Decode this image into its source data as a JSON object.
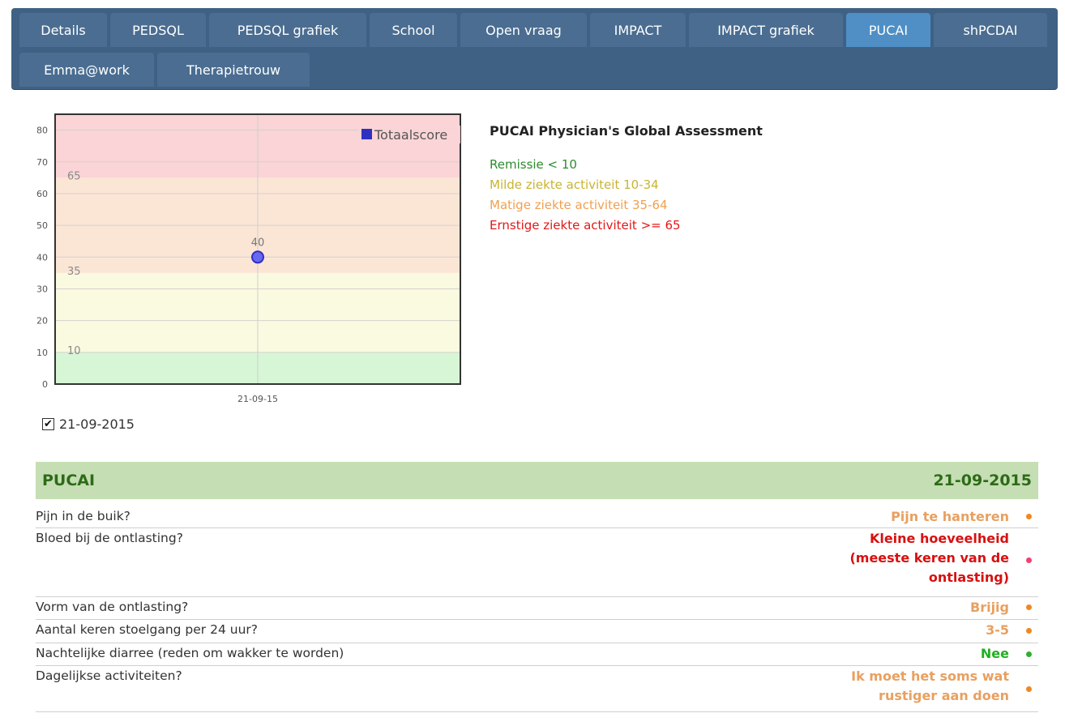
{
  "tabs": [
    {
      "label": "Details",
      "active": false
    },
    {
      "label": "PEDSQL",
      "active": false
    },
    {
      "label": "PEDSQL grafiek",
      "active": false
    },
    {
      "label": "School",
      "active": false
    },
    {
      "label": "Open vraag",
      "active": false
    },
    {
      "label": "IMPACT",
      "active": false
    },
    {
      "label": "IMPACT grafiek",
      "active": false
    },
    {
      "label": "PUCAI",
      "active": true
    },
    {
      "label": "shPCDAI",
      "active": false
    },
    {
      "label": "Emma@work",
      "active": false
    },
    {
      "label": "Therapietrouw",
      "active": false
    }
  ],
  "chart_data": {
    "type": "scatter",
    "title": "",
    "xlabel": "",
    "ylabel": "",
    "categories": [
      "21-09-15"
    ],
    "series": [
      {
        "name": "Totaalscore",
        "values": [
          40
        ],
        "color": "#4848ee"
      }
    ],
    "data_labels": [
      "40"
    ],
    "ylim": [
      0,
      85
    ],
    "yticks": [
      0,
      10,
      20,
      30,
      40,
      50,
      60,
      70,
      80
    ],
    "grid": true,
    "legend": "top-right",
    "bands": [
      {
        "from": 0,
        "to": 10,
        "color": "#d6f6d6"
      },
      {
        "from": 10,
        "to": 35,
        "color": "#fafae0"
      },
      {
        "from": 35,
        "to": 65,
        "color": "#fbe6d6"
      },
      {
        "from": 65,
        "to": 85,
        "color": "#fad4d6"
      }
    ],
    "band_labels": [
      "10",
      "35",
      "65"
    ]
  },
  "date_checkbox": {
    "label": "21-09-2015",
    "checked": true
  },
  "legend_info": {
    "title": "PUCAI Physician's Global Assessment",
    "lines": [
      {
        "text": "Remissie < 10",
        "color": "green"
      },
      {
        "text": "Milde ziekte activiteit 10-34",
        "color": "yellow"
      },
      {
        "text": "Matige ziekte activiteit 35-64",
        "color": "orange"
      },
      {
        "text": "Ernstige ziekte activiteit >= 65",
        "color": "red"
      }
    ]
  },
  "pucai": {
    "title": "PUCAI",
    "date": "21-09-2015",
    "questions": [
      {
        "q": "Pijn in de buik?",
        "a_lines": [
          "Pijn te hanteren"
        ],
        "status": "orange"
      },
      {
        "q": "Bloed bij de ontlasting?",
        "a_lines": [
          "Kleine hoeveelheid",
          "(meeste keren van de",
          "ontlasting)"
        ],
        "status": "red"
      },
      {
        "q": "Vorm van de ontlasting?",
        "a_lines": [
          "Brijig"
        ],
        "status": "orange"
      },
      {
        "q": "Aantal keren stoelgang per 24 uur?",
        "a_lines": [
          "3-5"
        ],
        "status": "orange"
      },
      {
        "q": "Nachtelijke diarree (reden om wakker te worden)",
        "a_lines": [
          "Nee"
        ],
        "status": "green"
      },
      {
        "q": "Dagelijkse activiteiten?",
        "a_lines": [
          "Ik moet het soms wat",
          "rustiger aan doen"
        ],
        "status": "orange"
      }
    ]
  }
}
